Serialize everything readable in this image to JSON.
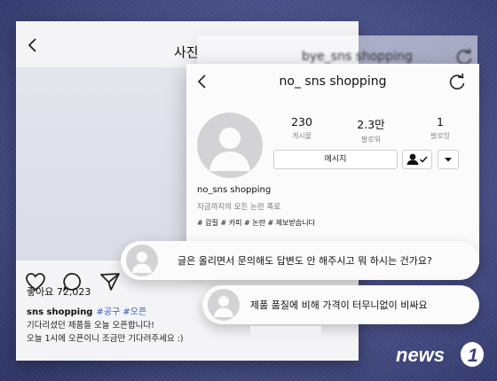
{
  "post": {
    "header_title": "사진",
    "likes_label": "좋아요 72,023",
    "caption_user": "sns shopping",
    "caption_tags": "#공구 #오픈",
    "caption_line2": "기다리셨던 제품들 오늘 오픈합니다!",
    "caption_line3": "오늘 1시에 오픈이니 조금만 기다려주세요 :)"
  },
  "profile_back": {
    "username": "bye_sns shopping"
  },
  "profile": {
    "username": "no_ sns shopping",
    "stats": [
      {
        "value": "230",
        "label": "게시물"
      },
      {
        "value": "2.3만",
        "label": "팔로워"
      },
      {
        "value": "1",
        "label": "팔로잉"
      }
    ],
    "message_label": "메시지",
    "bio_name": "no_sns shopping",
    "bio_desc": "지금까지의 모든 논란 폭로",
    "bio_tags": "# 갑질 # 카피 # 논란 # 제보받습니다"
  },
  "comments": [
    {
      "text": "글은 올리면서 문의해도 답변도 안 해주시고 뭐 하시는 건가요?"
    },
    {
      "text": "제품 품질에 비해 가격이 터무니없이 비싸요"
    }
  ],
  "watermark": {
    "brand": "news",
    "number": "1",
    "color": "#ffffff"
  },
  "icons": [
    "back-arrow-icon",
    "heart-icon",
    "comment-icon",
    "send-icon",
    "refresh-icon",
    "follow-check-icon",
    "dropdown-arrow-icon",
    "avatar-placeholder-icon"
  ]
}
